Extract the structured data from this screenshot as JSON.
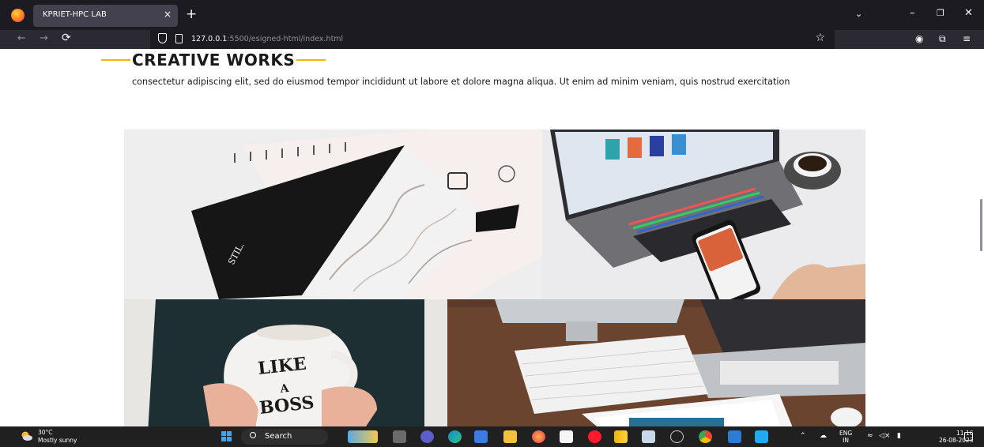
{
  "browser": {
    "tab_title": "KPRIET-HPC LAB",
    "tab_close": "×",
    "new_tab": "+",
    "url_host": "127.0.0.1",
    "url_path": ":5500/esigned-html/index.html"
  },
  "page": {
    "section_title": "CREATIVE WORKS",
    "intro": "consectetur adipiscing elit, sed do eiusmod tempor incididunt ut labore et dolore magna aliqua. Ut enim ad minim veniam, quis nostrud exercitation",
    "accent_color": "#f2b705",
    "mug_text_line1": "LIKE",
    "mug_text_line2": "A",
    "mug_text_line3": "BOSS",
    "notebook_text": "STIL."
  },
  "taskbar": {
    "weather_temp": "30°C",
    "weather_desc": "Mostly sunny",
    "search_label": "Search",
    "lang_top": "ENG",
    "lang_bottom": "IN",
    "time": "11:16",
    "date": "26-08-2023"
  }
}
